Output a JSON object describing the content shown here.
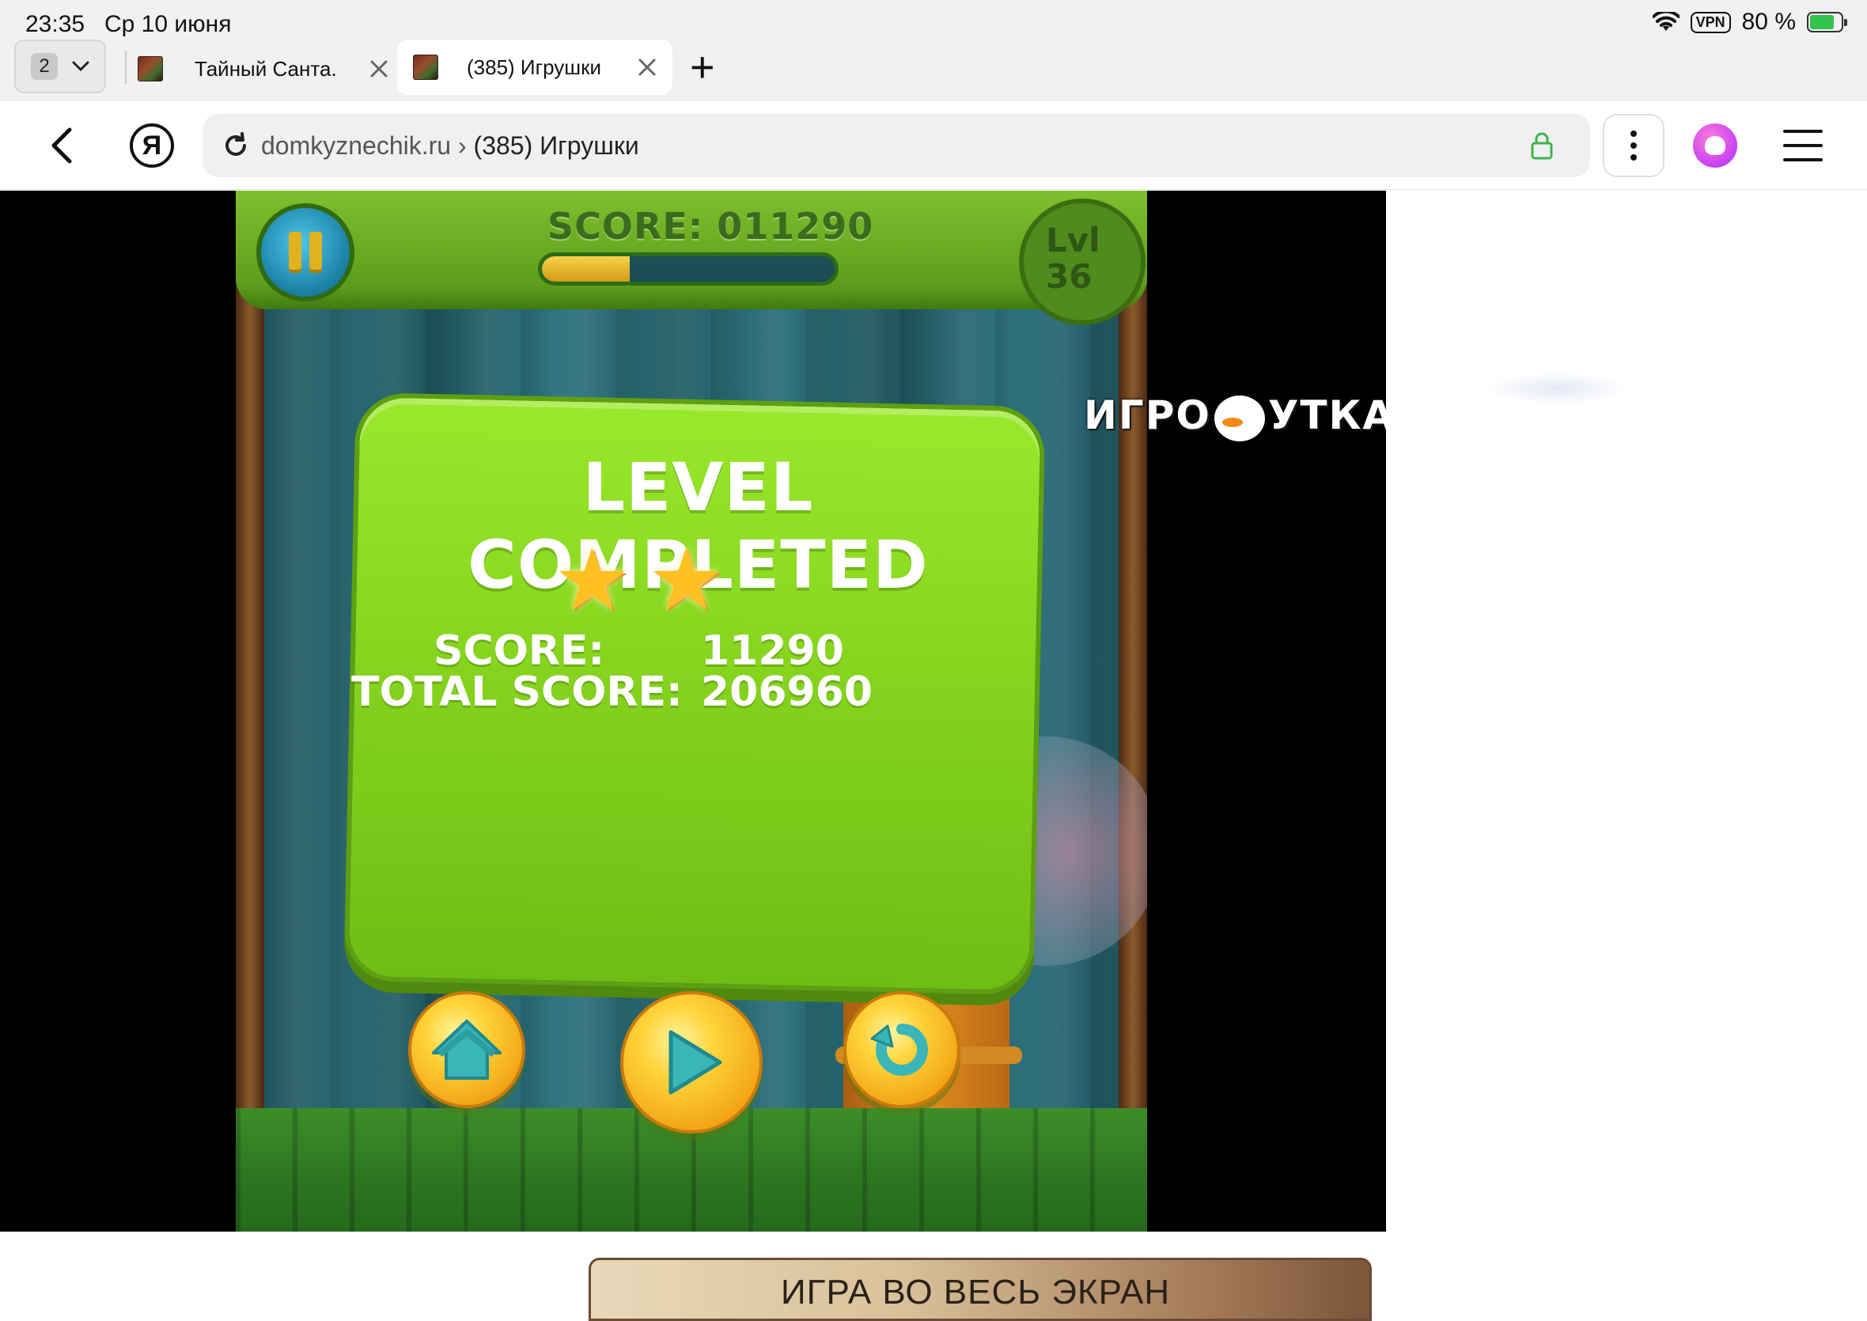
{
  "status_bar": {
    "time": "23:35",
    "date": "Ср 10 июня",
    "vpn_label": "VPN",
    "battery_text": "80 %",
    "battery_level": 0.8
  },
  "tab_bar": {
    "tab_count": "2",
    "tabs": [
      {
        "title": "Тайный Санта."
      },
      {
        "title": "(385) Игрушки"
      }
    ],
    "new_tab_symbol": "+"
  },
  "address_bar": {
    "yandex_logo": "Я",
    "domain": "domkyznechik.ru",
    "separator": "›",
    "page_title": "(385) Игрушки"
  },
  "game": {
    "top_score_label": "SCORE:",
    "top_score_value": "011290",
    "level_progress": 0.3,
    "level_label": "Lvl",
    "level_number": "36",
    "watermark_left": "ИГРО",
    "watermark_right": "УТКА",
    "dialog": {
      "title": "LEVEL COMPLETED",
      "stars_earned": 2,
      "score_label": "SCORE:",
      "score_value": "11290",
      "total_score_label": "TOTAL SCORE:",
      "total_score_value": "206960"
    },
    "colors": {
      "dialog_green": "#86d41e",
      "button_yellow": "#ffd43a",
      "button_icon_teal": "#3ab5b8"
    }
  },
  "page": {
    "fullscreen_button": "ИГРА ВО ВЕСЬ ЭКРАН"
  }
}
